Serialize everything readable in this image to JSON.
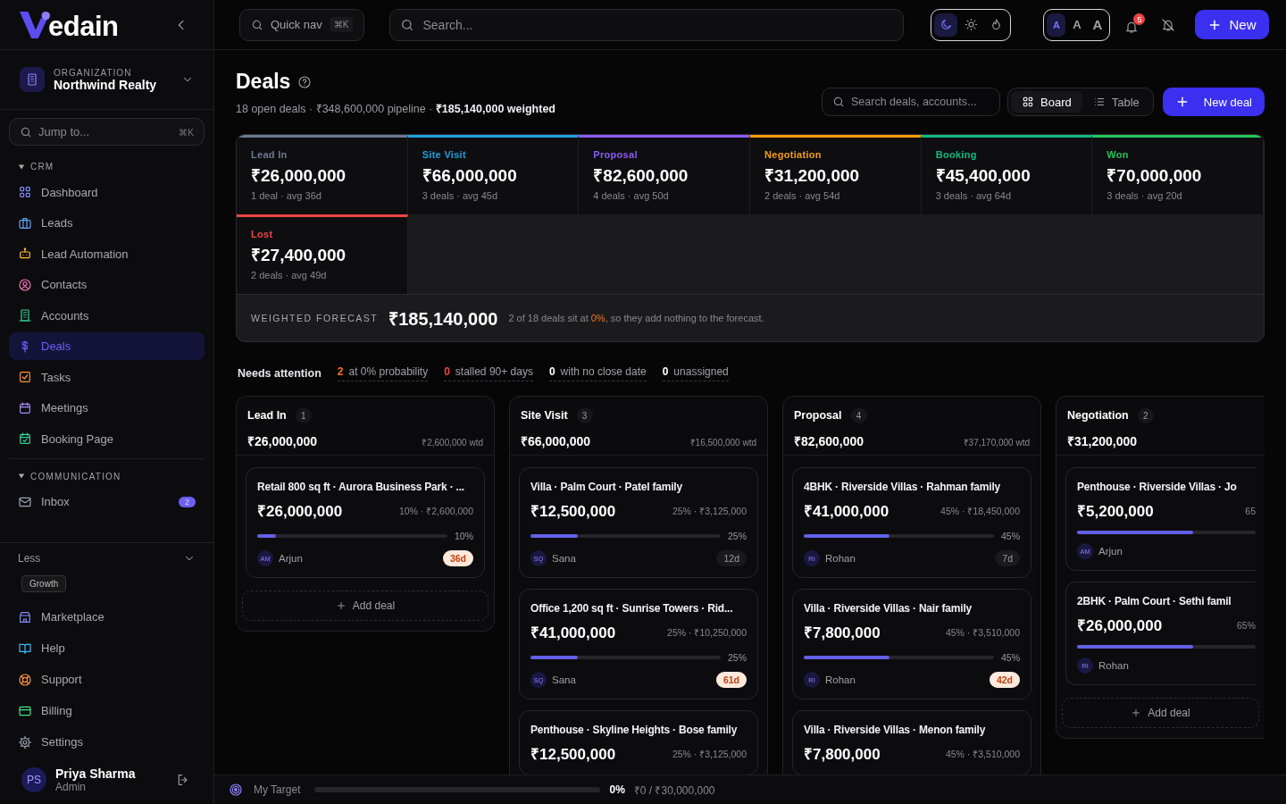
{
  "sidebar": {
    "logo": "edain",
    "org": {
      "label": "ORGANIZATION",
      "name": "Northwind Realty"
    },
    "jump": {
      "placeholder": "Jump to...",
      "shortcut": "⌘K"
    },
    "sections": [
      {
        "title": "CRM",
        "expanded": true,
        "items": [
          {
            "label": "Dashboard",
            "kind": "dashboard",
            "selected": false
          },
          {
            "label": "Leads",
            "kind": "briefcase",
            "selected": false
          },
          {
            "label": "Lead Automation",
            "kind": "robot",
            "selected": false
          },
          {
            "label": "Contacts",
            "kind": "contact",
            "selected": false
          },
          {
            "label": "Accounts",
            "kind": "building",
            "selected": false
          },
          {
            "label": "Deals",
            "kind": "dollar",
            "selected": true
          },
          {
            "label": "Tasks",
            "kind": "task",
            "selected": false
          },
          {
            "label": "Meetings",
            "kind": "calendar",
            "selected": false
          },
          {
            "label": "Booking Page",
            "kind": "calcheck",
            "selected": false
          }
        ]
      },
      {
        "title": "COMMUNICATION",
        "expanded": true,
        "items": [
          {
            "label": "Inbox",
            "kind": "mail",
            "selected": false,
            "badge": "2"
          }
        ]
      }
    ],
    "less": {
      "label": "Less",
      "chip": "Growth"
    },
    "footer_items": [
      {
        "label": "Marketplace",
        "kind": "store"
      },
      {
        "label": "Help",
        "kind": "book"
      },
      {
        "label": "Support",
        "kind": "lifebuoy"
      },
      {
        "label": "Billing",
        "kind": "card"
      },
      {
        "label": "Settings",
        "kind": "gear"
      }
    ],
    "user": {
      "initials": "PS",
      "name": "Priya Sharma",
      "role": "Admin"
    }
  },
  "topbar": {
    "quick_nav": {
      "label": "Quick nav",
      "shortcut": "⌘K"
    },
    "search": {
      "placeholder": "Search..."
    },
    "themes": [
      {
        "kind": "dark",
        "selected": true
      },
      {
        "kind": "light",
        "selected": false
      },
      {
        "kind": "warm",
        "selected": false
      }
    ],
    "font_sizes": [
      {
        "label": "A",
        "selected": true
      },
      {
        "label": "A",
        "selected": false
      },
      {
        "label": "A",
        "selected": false
      }
    ],
    "notifications": "5",
    "new_button": "New"
  },
  "header": {
    "title": "Deals",
    "subtitle": "18 open deals · ₹348,600,000 pipeline · **₹185,140,000 weighted**",
    "search": {
      "placeholder": "Search deals, accounts..."
    },
    "views": [
      {
        "label": "Board",
        "kind": "grid",
        "selected": true
      },
      {
        "label": "Table",
        "kind": "list",
        "selected": false
      }
    ],
    "new_deal": "New deal"
  },
  "stages": [
    {
      "name": "Lead In",
      "color": "#6b7a90",
      "amount": "₹26,000,000",
      "summary": "1 deal · avg 36d"
    },
    {
      "name": "Site Visit",
      "color": "#1ea0e0",
      "amount": "₹66,000,000",
      "summary": "3 deals · avg 45d"
    },
    {
      "name": "Proposal",
      "color": "#8b5cf6",
      "amount": "₹82,600,000",
      "summary": "4 deals · avg 50d"
    },
    {
      "name": "Negotiation",
      "color": "#f59e0b",
      "amount": "₹31,200,000",
      "summary": "2 deals · avg 54d"
    },
    {
      "name": "Booking",
      "color": "#10b981",
      "amount": "₹45,400,000",
      "summary": "3 deals · avg 64d"
    },
    {
      "name": "Won",
      "color": "#22c55e",
      "amount": "₹70,000,000",
      "summary": "3 deals · avg 20d"
    },
    {
      "name": "Lost",
      "color": "#ef4444",
      "amount": "₹27,400,000",
      "summary": "2 deals · avg 49d"
    }
  ],
  "forecast": {
    "label": "WEIGHTED FORECAST",
    "amount": "₹185,140,000",
    "note": [
      "2 of 18 deals sit at ",
      "0%",
      ", so they add nothing to the forecast."
    ]
  },
  "attention": {
    "label": "Needs attention",
    "items": [
      {
        "count": "2",
        "label": "at 0% probability",
        "color": "#f97316"
      },
      {
        "count": "0",
        "label": "stalled 90+ days",
        "color": "#ef4444"
      },
      {
        "count": "0",
        "label": "with no close date",
        "color": "#ffffff"
      },
      {
        "count": "0",
        "label": "unassigned",
        "color": "#ffffff"
      }
    ]
  },
  "columns": [
    {
      "name": "Lead In",
      "count": "1",
      "total": "₹26,000,000",
      "weighted": "₹2,600,000 wtd",
      "add_deal": "Add deal",
      "cards": [
        {
          "title": "Retail 800 sq ft · Aurora Business Park · ...",
          "amount": "₹26,000,000",
          "meta": "10% · ₹2,600,000",
          "level": 0.1,
          "pct": "10%",
          "initials": "AM",
          "owner": "Arjun",
          "age": "36d",
          "age_alert": true
        }
      ]
    },
    {
      "name": "Site Visit",
      "count": "3",
      "total": "₹66,000,000",
      "weighted": "₹16,500,000 wtd",
      "cards": [
        {
          "title": "Villa · Palm Court · Patel family",
          "amount": "₹12,500,000",
          "meta": "25% · ₹3,125,000",
          "level": 0.25,
          "pct": "25%",
          "initials": "SQ",
          "owner": "Sana",
          "age": "12d",
          "age_alert": false
        },
        {
          "title": "Office 1,200 sq ft · Sunrise Towers · Rid...",
          "amount": "₹41,000,000",
          "meta": "25% · ₹10,250,000",
          "level": 0.25,
          "pct": "25%",
          "initials": "SQ",
          "owner": "Sana",
          "age": "61d",
          "age_alert": true
        },
        {
          "title": "Penthouse · Skyline Heights · Bose family",
          "amount": "₹12,500,000",
          "meta": "25% · ₹3,125,000"
        }
      ]
    },
    {
      "name": "Proposal",
      "count": "4",
      "total": "₹82,600,000",
      "weighted": "₹37,170,000 wtd",
      "cards": [
        {
          "title": "4BHK · Riverside Villas · Rahman family",
          "amount": "₹41,000,000",
          "meta": "45% · ₹18,450,000",
          "level": 0.45,
          "pct": "45%",
          "initials": "RI",
          "owner": "Rohan",
          "age": "7d",
          "age_alert": false
        },
        {
          "title": "Villa · Riverside Villas · Nair family",
          "amount": "₹7,800,000",
          "meta": "45% · ₹3,510,000",
          "level": 0.45,
          "pct": "45%",
          "initials": "RI",
          "owner": "Rohan",
          "age": "42d",
          "age_alert": true
        },
        {
          "title": "Villa · Riverside Villas · Menon family",
          "amount": "₹7,800,000",
          "meta": "45% · ₹3,510,000"
        }
      ]
    },
    {
      "name": "Negotiation",
      "count": "2",
      "total": "₹31,200,000",
      "add_deal": "Add deal",
      "cards": [
        {
          "title": "Penthouse · Riverside Villas · Jo",
          "amount": "₹5,200,000",
          "meta": "65",
          "level": 0.65,
          "initials": "AM",
          "owner": "Arjun"
        },
        {
          "title": "2BHK · Palm Court · Sethi famil",
          "amount": "₹26,000,000",
          "meta": "65%",
          "level": 0.65,
          "initials": "RI",
          "owner": "Rohan"
        }
      ]
    }
  ],
  "target": {
    "label": "My Target",
    "level": 0,
    "pct": "0%",
    "progress": "₹0 / ₹30,000,000"
  }
}
